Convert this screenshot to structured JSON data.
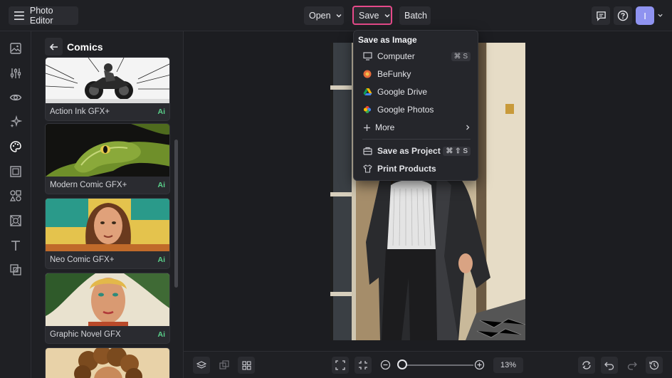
{
  "header": {
    "app_title": "Photo Editor",
    "open_label": "Open",
    "save_label": "Save",
    "batch_label": "Batch",
    "avatar_initial": "I"
  },
  "panel": {
    "title": "Comics",
    "cards": [
      {
        "label": "Action Ink GFX+",
        "badge": "Ai"
      },
      {
        "label": "Modern Comic GFX+",
        "badge": "Ai"
      },
      {
        "label": "Neo Comic GFX+",
        "badge": "Ai"
      },
      {
        "label": "Graphic Novel GFX",
        "badge": "Ai"
      }
    ]
  },
  "save_menu": {
    "header": "Save as Image",
    "items": [
      {
        "label": "Computer",
        "shortcut": "⌘ S",
        "icon": "monitor-icon"
      },
      {
        "label": "BeFunky",
        "icon": "befunky-icon"
      },
      {
        "label": "Google Drive",
        "icon": "google-drive-icon"
      },
      {
        "label": "Google Photos",
        "icon": "google-photos-icon"
      },
      {
        "label": "More",
        "icon": "plus-icon"
      },
      {
        "label": "Save as Project",
        "shortcut": "⌘ ⇧ S",
        "icon": "project-icon"
      },
      {
        "label": "Print Products",
        "icon": "shirt-icon"
      }
    ]
  },
  "bottom": {
    "zoom_value": "13%"
  },
  "colors": {
    "accent": "#e64a8a",
    "ai_badge": "#5ad08a",
    "avatar": "#8f93f0"
  }
}
